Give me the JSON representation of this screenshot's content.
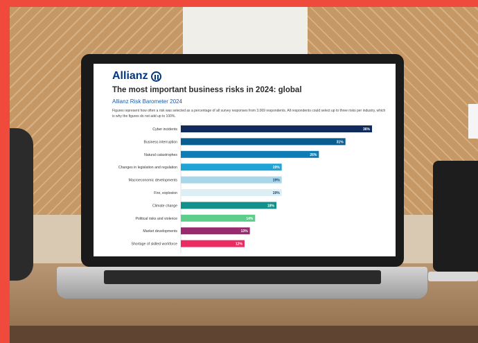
{
  "brand": {
    "name": "Allianz"
  },
  "chart_data": {
    "type": "bar",
    "orientation": "horizontal",
    "title": "The most important business risks in 2024: global",
    "subtitle": "Allianz Risk Barometer 2024",
    "note": "Figures represent how often a risk was selected as a percentage of all survey responses from 3,069 respondents. All respondents could select up to three risks per industry, which is why the figures do not add up to 100%.",
    "categories": [
      "Cyber incidents",
      "Business interruption",
      "Natural catastrophes",
      "Changes in legislation and regulation",
      "Macroeconomic developments",
      "Fire, explosion",
      "Climate change",
      "Political risks and violence",
      "Market developments",
      "Shortage of skilled workforce"
    ],
    "values": [
      36,
      31,
      26,
      19,
      19,
      19,
      18,
      14,
      13,
      12
    ],
    "value_labels": [
      "36%",
      "31%",
      "26%",
      "19%",
      "19%",
      "19%",
      "18%",
      "14%",
      "13%",
      "12%"
    ],
    "colors": [
      "#122b5e",
      "#0b5c8f",
      "#0e7db5",
      "#1ea4d6",
      "#a9d6e8",
      "#dceff5",
      "#139089",
      "#5ccd8a",
      "#9a2a6f",
      "#ea2c62"
    ],
    "xlim": [
      0,
      36
    ]
  }
}
